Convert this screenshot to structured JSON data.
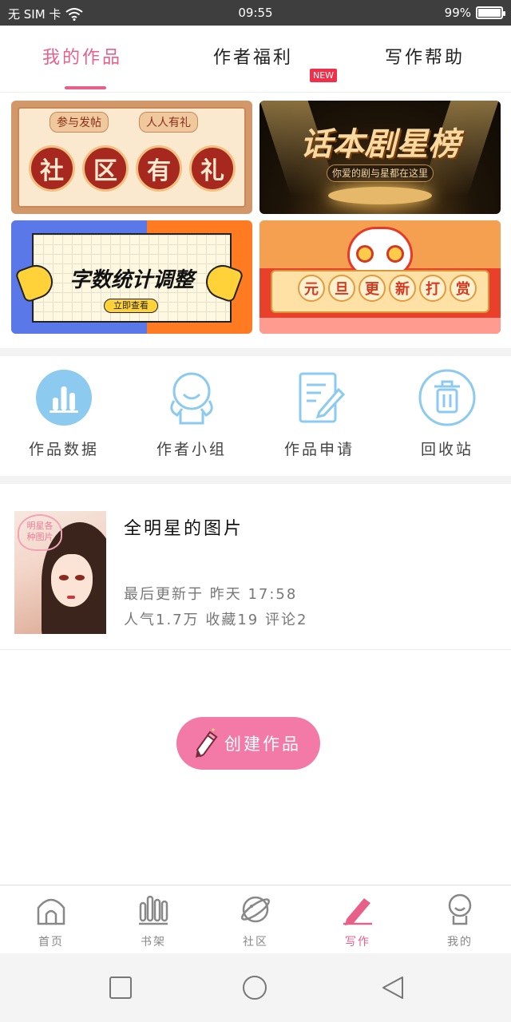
{
  "status_bar": {
    "carrier": "无 SIM 卡",
    "time": "09:55",
    "battery": "99%",
    "battery_level": 0.99
  },
  "tabs": [
    {
      "label": "我的作品",
      "active": true
    },
    {
      "label": "作者福利",
      "active": false,
      "badge": "NEW"
    },
    {
      "label": "写作帮助",
      "active": false
    }
  ],
  "banners": {
    "community": {
      "tag_left": "参与发帖",
      "tag_right": "人人有礼",
      "chars": [
        "社",
        "区",
        "有",
        "礼"
      ]
    },
    "star": {
      "title": "话本剧星榜",
      "subtitle": "你爱的剧与星都在这里"
    },
    "wordcount": {
      "title": "字数统计调整",
      "button": "立即查看"
    },
    "newyear": {
      "chars": [
        "元",
        "旦",
        "更",
        "新",
        "打",
        "赏"
      ]
    }
  },
  "quick_actions": [
    {
      "label": "作品数据",
      "icon": "bar-chart-icon"
    },
    {
      "label": "作者小组",
      "icon": "group-icon"
    },
    {
      "label": "作品申请",
      "icon": "edit-doc-icon"
    },
    {
      "label": "回收站",
      "icon": "trash-icon"
    }
  ],
  "work": {
    "cover_text": "明星各种图片",
    "cover_text_line1": "明星各",
    "cover_text_line2": "种图片",
    "title": "全明星的图片",
    "last_update": "最后更新于 昨天 17:58",
    "stats": "人气1.7万 收藏19 评论2"
  },
  "create_button": "创建作品",
  "bottom_nav": [
    {
      "label": "首页",
      "icon": "home-icon",
      "active": false
    },
    {
      "label": "书架",
      "icon": "bookshelf-icon",
      "active": false
    },
    {
      "label": "社区",
      "icon": "planet-icon",
      "active": false
    },
    {
      "label": "写作",
      "icon": "pen-icon",
      "active": true
    },
    {
      "label": "我的",
      "icon": "profile-icon",
      "active": false
    }
  ],
  "colors": {
    "accent": "#e8608a",
    "create_button": "#f37aa6",
    "icon_blue": "#8ccaf0"
  }
}
